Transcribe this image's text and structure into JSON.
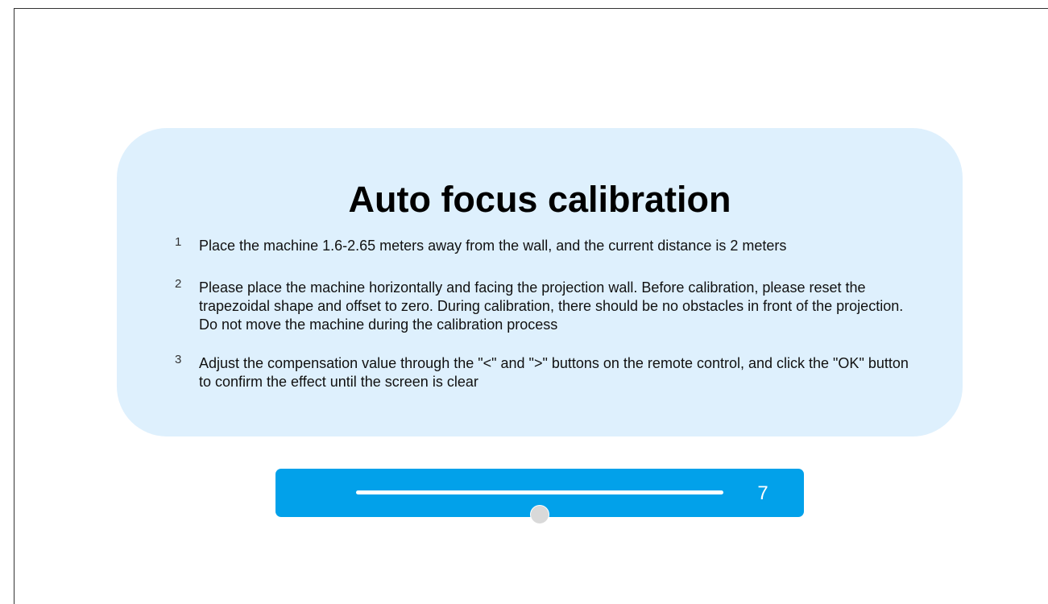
{
  "dialog": {
    "title": "Auto focus calibration",
    "steps": [
      {
        "number": "1",
        "text": "Place the machine 1.6-2.65 meters away from the wall, and the current distance is 2 meters"
      },
      {
        "number": "2",
        "text": "Please place the machine horizontally and facing the projection wall. Before calibration, please reset the trapezoidal shape and offset to zero. During calibration, there should be no obstacles in front of the projection. Do not move the machine during the calibration process"
      },
      {
        "number": "3",
        "text": "Adjust the compensation value through the \"<\" and \">\" buttons on the remote control, and click the \"OK\" button to confirm the effect until the screen is clear"
      }
    ]
  },
  "slider": {
    "value": "7",
    "position_fraction": 0.5,
    "bar_color": "#02a1ea",
    "track_color": "#ffffff",
    "thumb_color": "#d9d9d9"
  },
  "colors": {
    "card_background": "#def0fd",
    "page_background": "#ffffff"
  }
}
